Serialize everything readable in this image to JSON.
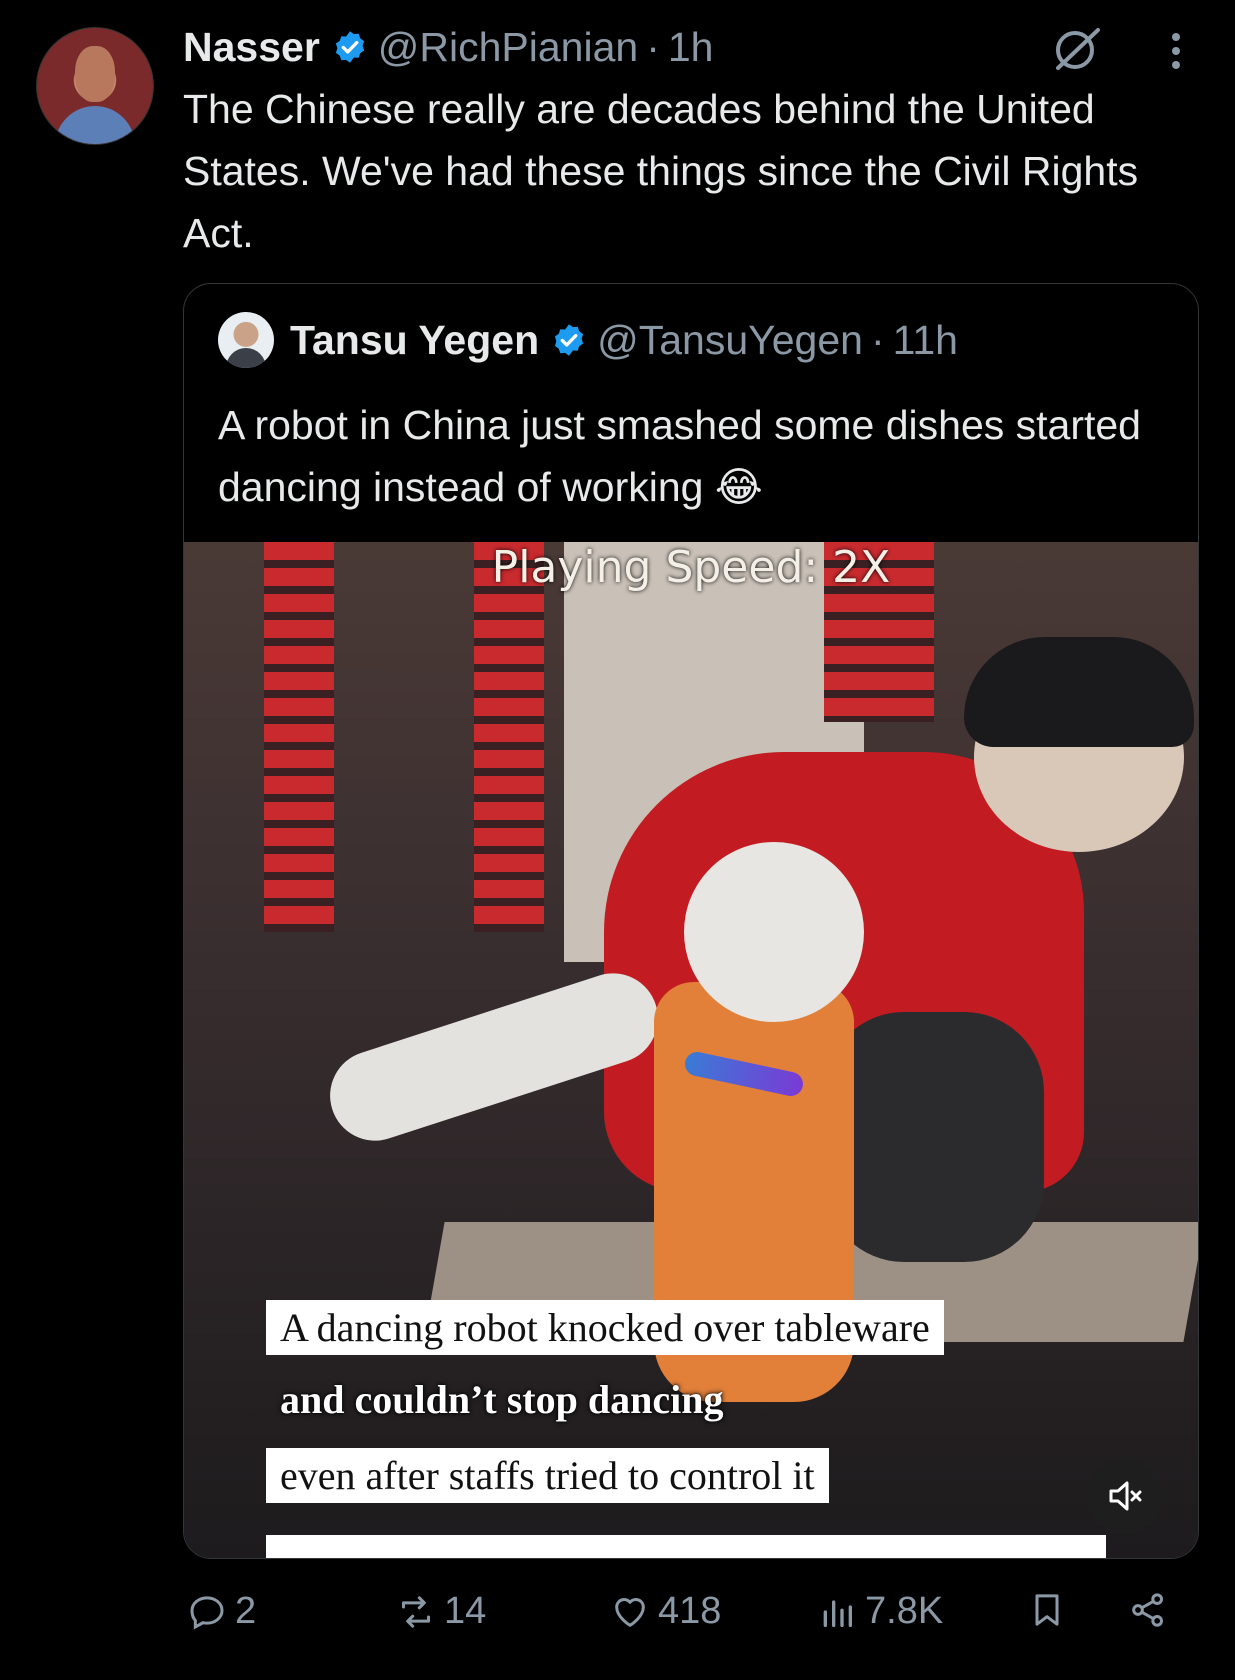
{
  "tweet": {
    "author_name": "Nasser",
    "author_handle": "@RichPianian",
    "separator": "·",
    "time": "1h",
    "text": "The Chinese really are decades behind the United States. We've had these things since the Civil Rights Act."
  },
  "quote": {
    "author_name": "Tansu Yegen",
    "author_handle": "@TansuYegen",
    "separator": "·",
    "time": "11h",
    "text": "A robot in China just smashed some dishes started dancing instead of working 😂"
  },
  "video": {
    "speed_label": "Playing Speed: 2X",
    "captions": [
      "A dancing robot knocked over tableware",
      "and couldn’t stop dancing",
      "even after staffs tried to control it"
    ],
    "muted": true
  },
  "actions": {
    "replies": "2",
    "reposts": "14",
    "likes": "418",
    "views": "7.8K"
  },
  "icons": {
    "verified": "verified-badge-icon",
    "grok": "grok-icon",
    "more": "more-vertical-icon",
    "reply": "reply-icon",
    "repost": "repost-icon",
    "like": "heart-icon",
    "views": "views-icon",
    "bookmark": "bookmark-icon",
    "share": "share-icon",
    "mute": "muted-speaker-icon"
  },
  "colors": {
    "background": "#000000",
    "text": "#e7e9ea",
    "secondary": "#8b98a5",
    "verified": "#1d9bf0",
    "border": "#333639"
  }
}
